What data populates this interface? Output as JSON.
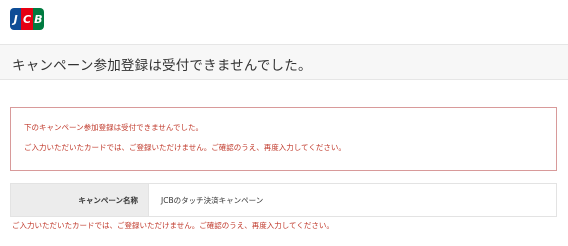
{
  "header": {
    "logo_letters": [
      "J",
      "C",
      "B"
    ],
    "logo_colors": [
      "#0e4c96",
      "#e60012",
      "#007b40"
    ]
  },
  "page_title": "キャンペーン参加登録は受付できませんでした。",
  "error_box": {
    "line1": "下のキャンペーン参加登録は受付できませんでした。",
    "line2": "ご入力いただいたカードでは、ご登録いただけません。ご確認のうえ、再度入力してください。"
  },
  "campaign_table": {
    "header": "キャンペーン名称",
    "value": "JCBのタッチ決済キャンペーン"
  },
  "bottom_error": "ご入力いただいたカードでは、ご登録いただけません。ご確認のうえ、再度入力してください。",
  "colors": {
    "error_text": "#c0392b",
    "error_border": "#d89a9a",
    "title_bar_bg": "#f7f7f7",
    "table_header_bg": "#ececec"
  }
}
